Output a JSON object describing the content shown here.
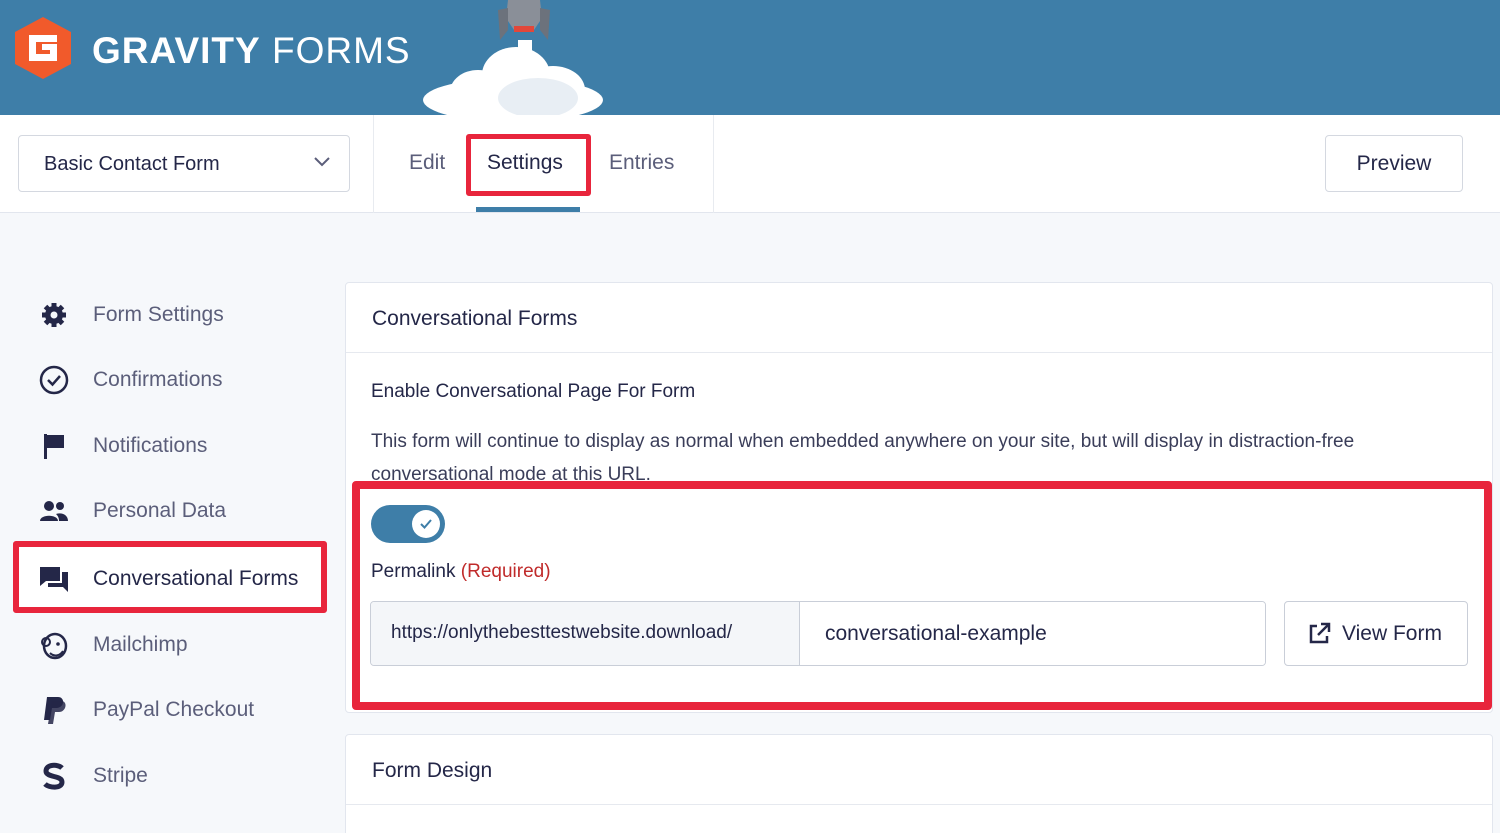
{
  "header": {
    "brand_bold": "GRAVITY",
    "brand_light": "FORMS"
  },
  "toolbar": {
    "form_select": "Basic Contact Form",
    "tabs": [
      {
        "label": "Edit"
      },
      {
        "label": "Settings"
      },
      {
        "label": "Entries"
      }
    ],
    "preview_label": "Preview"
  },
  "sidebar": {
    "items": [
      {
        "label": "Form Settings",
        "icon": "gear-icon"
      },
      {
        "label": "Confirmations",
        "icon": "check-circle-icon"
      },
      {
        "label": "Notifications",
        "icon": "flag-icon"
      },
      {
        "label": "Personal Data",
        "icon": "people-icon"
      },
      {
        "label": "Conversational Forms",
        "icon": "chat-bubbles-icon"
      },
      {
        "label": "Mailchimp",
        "icon": "mailchimp-icon"
      },
      {
        "label": "PayPal Checkout",
        "icon": "paypal-icon"
      },
      {
        "label": "Stripe",
        "icon": "stripe-icon"
      }
    ]
  },
  "conversational": {
    "panel_title": "Conversational Forms",
    "field_title": "Enable Conversational Page For Form",
    "description": "This form will continue to display as normal when embedded anywhere on your site, but will display in distraction-free conversational mode at this URL.",
    "toggle_on": true,
    "permalink_label": "Permalink",
    "required_label": "(Required)",
    "url_prefix": "https://onlythebesttestwebsite.download/",
    "slug_value": "conversational-example",
    "view_form_label": "View Form"
  },
  "form_design": {
    "panel_title": "Form Design"
  },
  "colors": {
    "header_blue": "#3e7ea8",
    "highlight_red": "#e8253c",
    "logo_orange": "#f15a2b",
    "required_red": "#c02b2b"
  }
}
